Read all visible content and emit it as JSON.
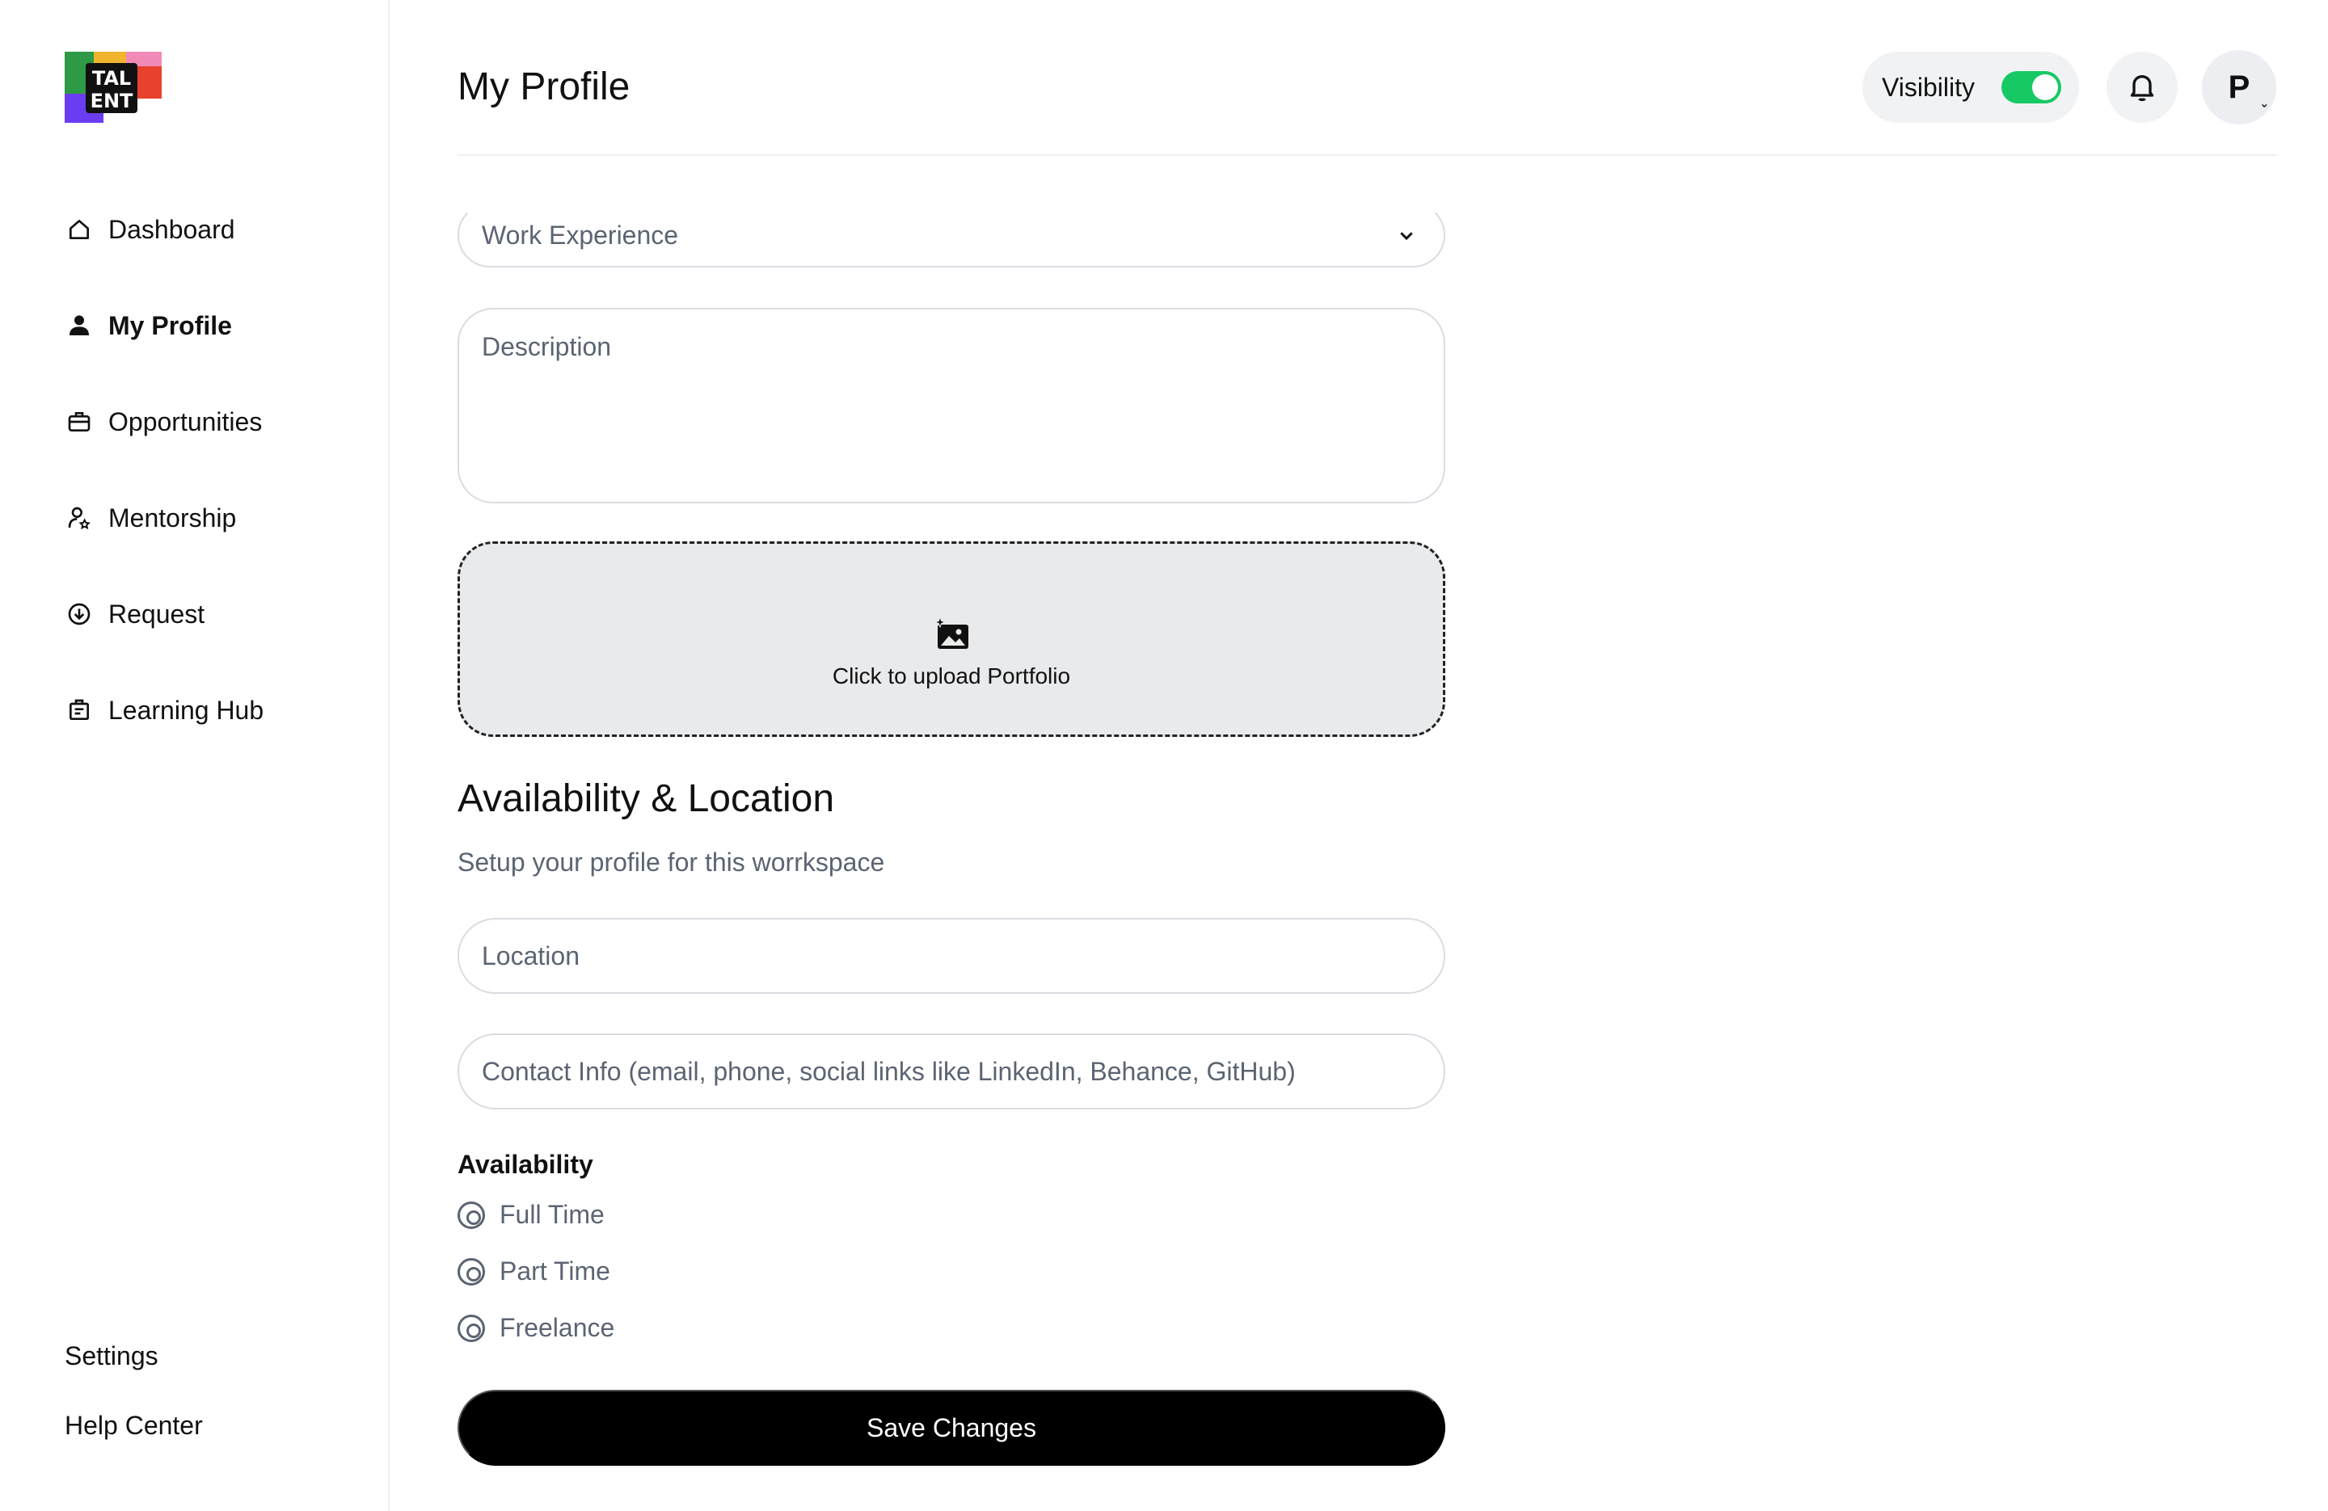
{
  "app": {
    "logo_text": "TALENT"
  },
  "sidebar": {
    "items": [
      {
        "label": "Dashboard",
        "icon": "home-icon"
      },
      {
        "label": "My Profile",
        "icon": "user-icon",
        "active": true
      },
      {
        "label": "Opportunities",
        "icon": "briefcase-icon"
      },
      {
        "label": "Mentorship",
        "icon": "mentor-icon"
      },
      {
        "label": "Request",
        "icon": "arrow-down-circle-icon"
      },
      {
        "label": "Learning Hub",
        "icon": "learning-icon"
      }
    ],
    "bottom": {
      "settings": "Settings",
      "help": "Help Center"
    }
  },
  "header": {
    "title": "My Profile",
    "visibility_label": "Visibility",
    "visibility_on": true,
    "avatar_initial": "P",
    "accent": "#17c964"
  },
  "form": {
    "work_experience_placeholder": "Work Experience",
    "description_placeholder": "Description",
    "upload_text": "Click to upload Portfolio",
    "section_title": "Availability & Location",
    "section_subtitle": "Setup your profile for this worrkspace",
    "location_placeholder": "Location",
    "contact_placeholder": "Contact Info  (email, phone, social links like LinkedIn, Behance, GitHub)",
    "availability_label": "Availability",
    "availability_options": [
      "Full Time",
      "Part Time",
      "Freelance"
    ],
    "save_label": "Save Changes"
  }
}
